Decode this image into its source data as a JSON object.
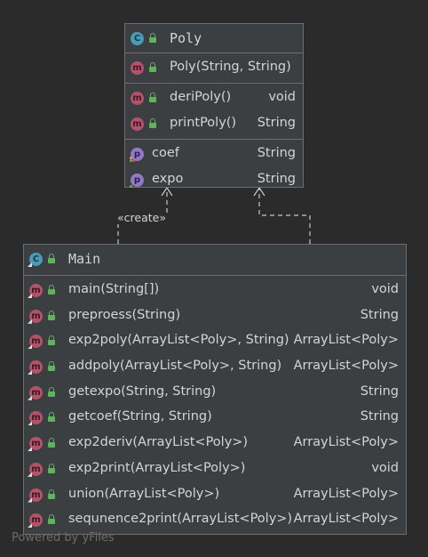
{
  "poly": {
    "name": "Poly",
    "constructors": [
      {
        "name": "Poly(String, String)",
        "type": ""
      }
    ],
    "methods": [
      {
        "name": "deriPoly()",
        "type": "void"
      },
      {
        "name": "printPoly()",
        "type": "String"
      }
    ],
    "fields": [
      {
        "name": "coef",
        "type": "String"
      },
      {
        "name": "expo",
        "type": "String"
      }
    ]
  },
  "main": {
    "name": "Main",
    "methods": [
      {
        "name": "main(String[])",
        "type": "void"
      },
      {
        "name": "preproess(String)",
        "type": "String"
      },
      {
        "name": "exp2poly(ArrayList<Poly>, String)",
        "type": "ArrayList<Poly>"
      },
      {
        "name": "addpoly(ArrayList<Poly>, String)",
        "type": "ArrayList<Poly>"
      },
      {
        "name": "getexpo(String, String)",
        "type": "String"
      },
      {
        "name": "getcoef(String, String)",
        "type": "String"
      },
      {
        "name": "exp2deriv(ArrayList<Poly>)",
        "type": "ArrayList<Poly>"
      },
      {
        "name": "exp2print(ArrayList<Poly>)",
        "type": "void"
      },
      {
        "name": "union(ArrayList<Poly>)",
        "type": "ArrayList<Poly>"
      },
      {
        "name": "sequnence2print(ArrayList<Poly>)",
        "type": "ArrayList<Poly>"
      }
    ]
  },
  "edge_label": "«create»",
  "footer": "Powered by yFiles",
  "colors": {
    "background": "#2b2b2b",
    "node": "#3c3f41",
    "border": "#6e6e6e",
    "class_badge": "#4a9bb5",
    "method_badge": "#b2536a",
    "field_badge": "#9279c8",
    "public_lock": "#5fb35f"
  },
  "icons": {
    "class": "class-c-icon",
    "method": "method-m-icon",
    "field": "field-p-icon",
    "visibility": "public-lock-icon"
  }
}
